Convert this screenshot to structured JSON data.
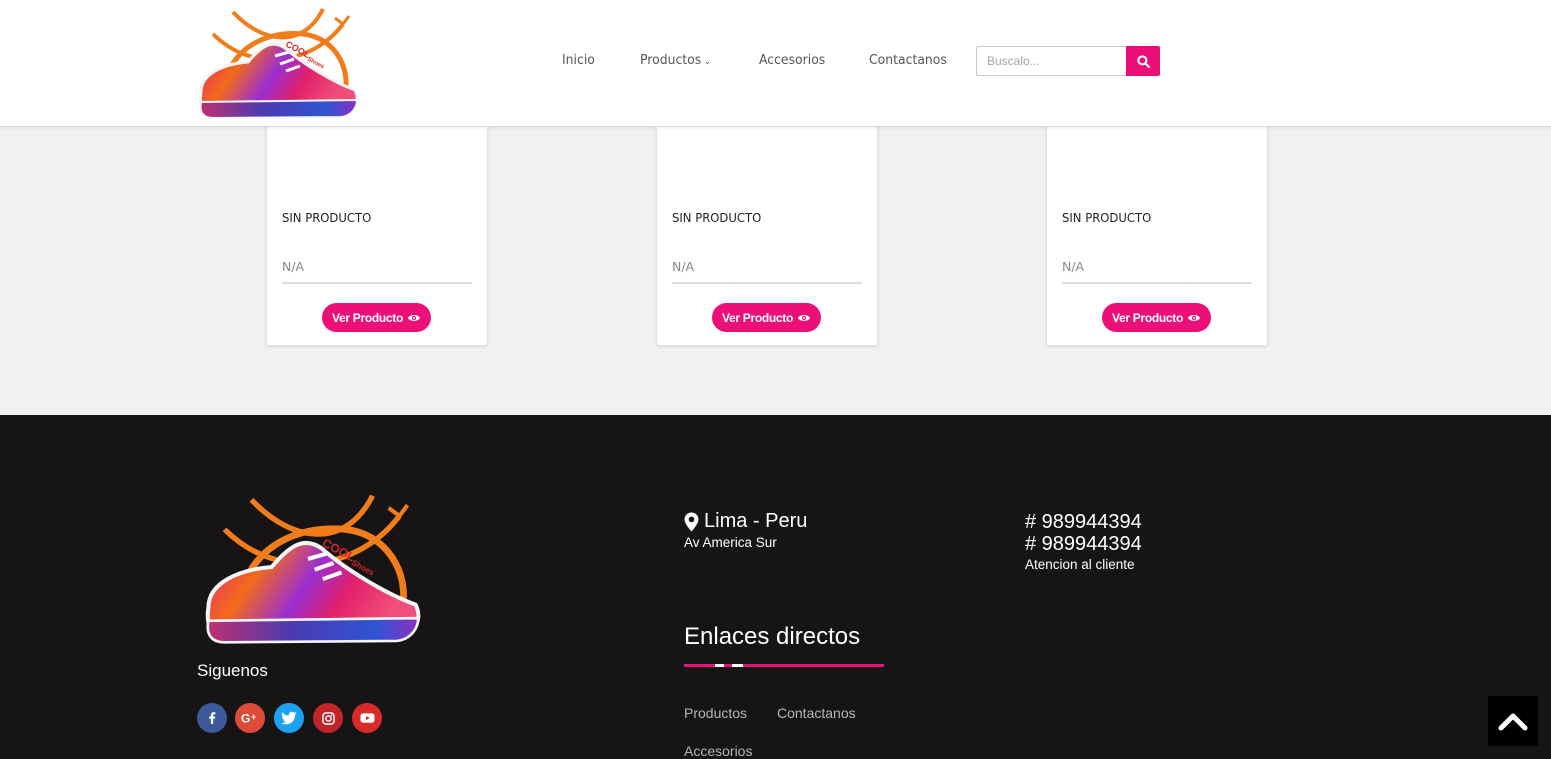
{
  "header": {
    "nav": [
      {
        "label": "Inicio"
      },
      {
        "label": "Productos"
      },
      {
        "label": "Accesorios"
      },
      {
        "label": "Contactanos"
      }
    ],
    "search": {
      "placeholder": "Buscalo..."
    },
    "logo": {
      "text": "COOL Shoes"
    }
  },
  "products": [
    {
      "name": "SIN PRODUCTO",
      "price": "N/A",
      "button_label": "Ver Producto"
    },
    {
      "name": "SIN PRODUCTO",
      "price": "N/A",
      "button_label": "Ver Producto"
    },
    {
      "name": "SIN PRODUCTO",
      "price": "N/A",
      "button_label": "Ver Producto"
    }
  ],
  "footer": {
    "follow_title": "Siguenos",
    "social": [
      {
        "icon": "facebook-icon",
        "color": "#3b5998"
      },
      {
        "icon": "google-plus-icon",
        "color": "#dd4b39"
      },
      {
        "icon": "twitter-icon",
        "color": "#1da1f2"
      },
      {
        "icon": "instagram-icon",
        "color": "#c0252a"
      },
      {
        "icon": "youtube-icon",
        "color": "#d92a2a"
      }
    ],
    "location": {
      "title": "Lima - Peru",
      "address": "Av America Sur"
    },
    "phones": [
      "# 989944394",
      "# 989944394"
    ],
    "phone_caption": "Atencion al cliente",
    "links_title": "Enlaces directos",
    "links": [
      {
        "label": "Productos"
      },
      {
        "label": "Contactanos"
      },
      {
        "label": "Accesorios"
      }
    ]
  },
  "colors": {
    "accent": "#ec0f77",
    "footer_bg": "#161415",
    "page_bg": "#f1f1f1"
  }
}
